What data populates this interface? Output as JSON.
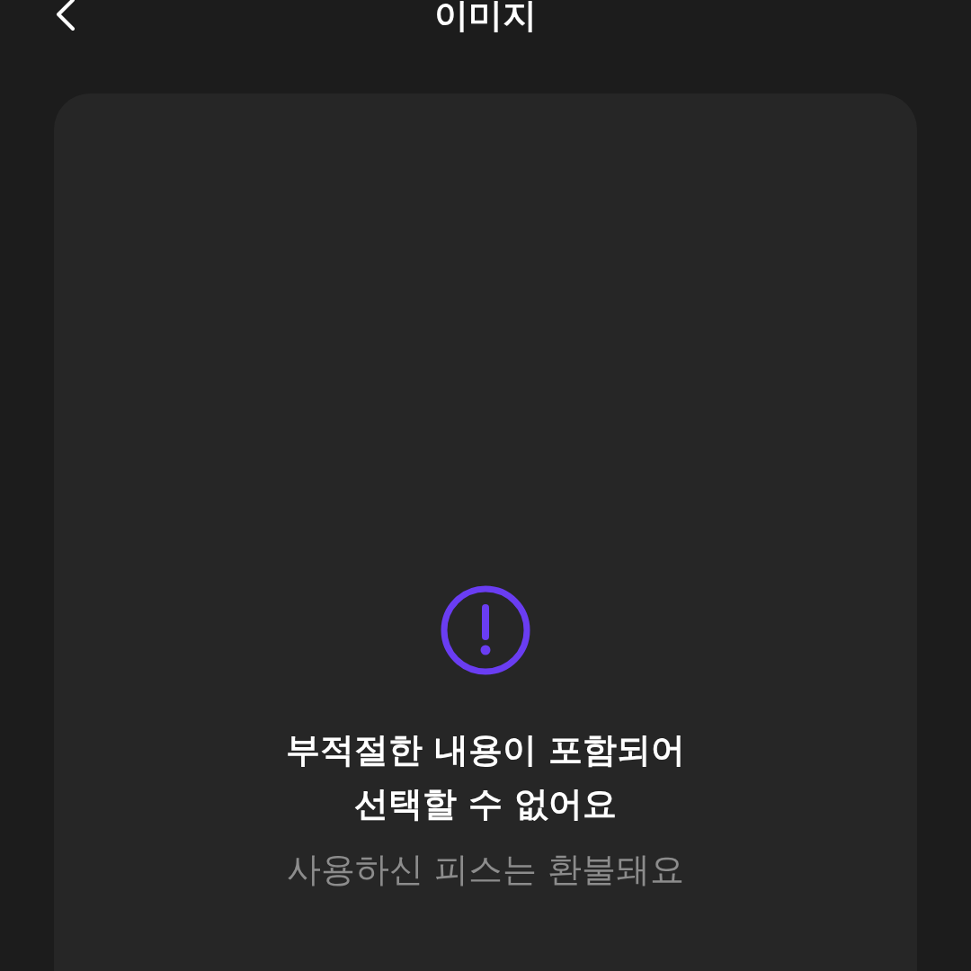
{
  "header": {
    "title": "이미지"
  },
  "notice": {
    "kind": "warning",
    "title": "부적절한 내용이 포함되어\n선택할 수 없어요",
    "subtitle": "사용하신 피스는 환불돼요"
  }
}
